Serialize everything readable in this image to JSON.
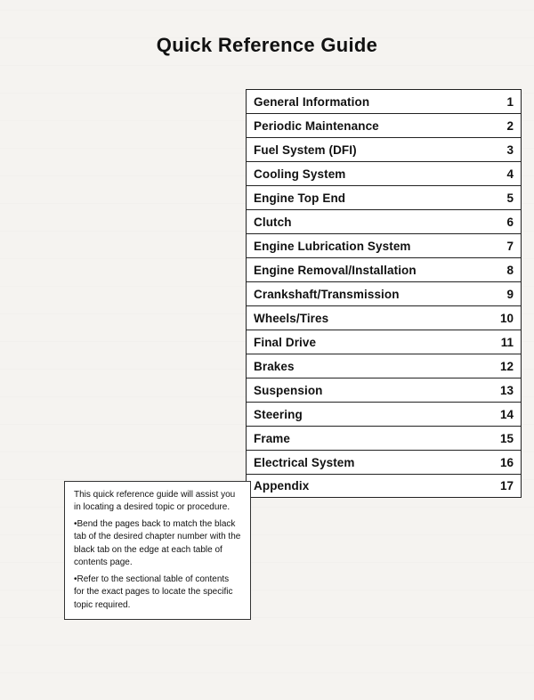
{
  "page": {
    "title": "Quick Reference Guide",
    "background_color": "#f5f3f0"
  },
  "toc": {
    "items": [
      {
        "label": "General Information",
        "number": "1"
      },
      {
        "label": "Periodic Maintenance",
        "number": "2"
      },
      {
        "label": "Fuel System (DFI)",
        "number": "3"
      },
      {
        "label": "Cooling System",
        "number": "4"
      },
      {
        "label": "Engine Top End",
        "number": "5"
      },
      {
        "label": "Clutch",
        "number": "6"
      },
      {
        "label": "Engine Lubrication System",
        "number": "7"
      },
      {
        "label": "Engine Removal/Installation",
        "number": "8"
      },
      {
        "label": "Crankshaft/Transmission",
        "number": "9"
      },
      {
        "label": "Wheels/Tires",
        "number": "10"
      },
      {
        "label": "Final Drive",
        "number": "11"
      },
      {
        "label": "Brakes",
        "number": "12"
      },
      {
        "label": "Suspension",
        "number": "13"
      },
      {
        "label": "Steering",
        "number": "14"
      },
      {
        "label": "Frame",
        "number": "15"
      },
      {
        "label": "Electrical System",
        "number": "16"
      },
      {
        "label": "Appendix",
        "number": "17"
      }
    ]
  },
  "note": {
    "lines": [
      "This quick reference guide will assist you in locating a desired topic or procedure.",
      "•Bend the pages back to match the black tab of the desired chapter number with the black tab on the edge at each table of contents page.",
      "•Refer to the sectional table of contents for the exact pages to locate the specific topic required."
    ]
  }
}
